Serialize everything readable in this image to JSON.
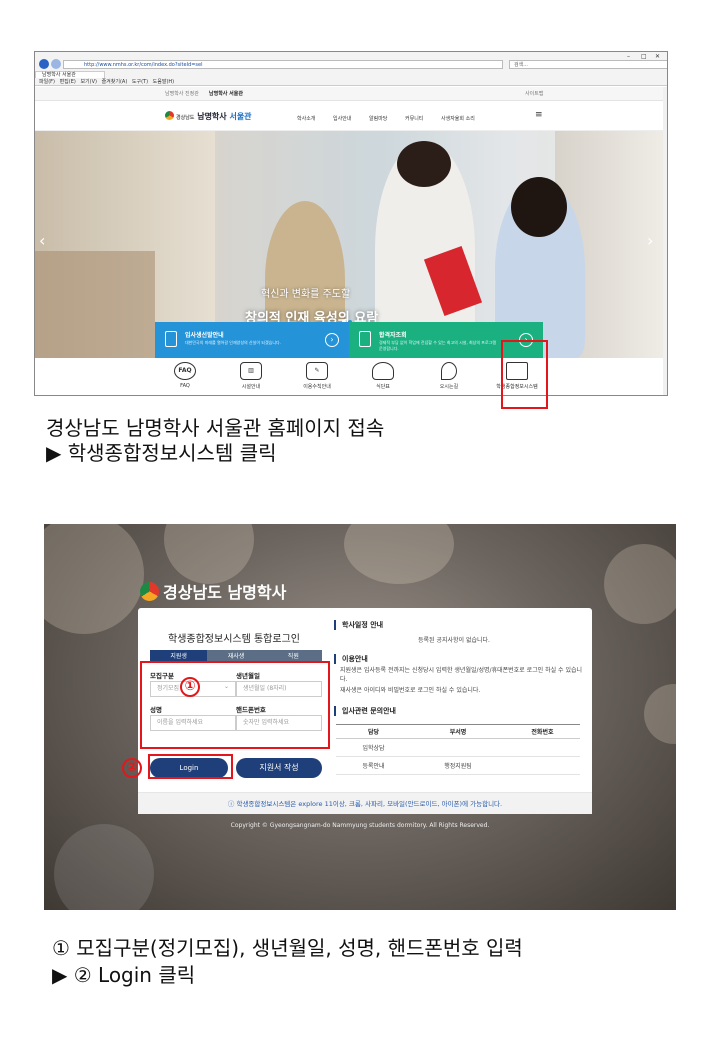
{
  "browser": {
    "url": "http://www.nmhs.or.kr/com/index.do?siteId=sel",
    "search_placeholder": "검색...",
    "tab_title": "남명학사 서울관",
    "menu_items": [
      "파일(F)",
      "편집(E)",
      "보기(V)",
      "즐겨찾기(A)",
      "도구(T)",
      "도움말(H)"
    ]
  },
  "site": {
    "top_links": [
      "남명학사 진정관",
      "남명학사 서울관"
    ],
    "top_right": "사이트맵",
    "logo_org": "경상남도",
    "logo_name": "남명학사",
    "logo_sub": "서울관",
    "gnb": [
      "학사소개",
      "입사안내",
      "알림마당",
      "커뮤니티",
      "사생자율회 소리"
    ],
    "hero_line1": "혁신과 변화를 주도할",
    "hero_line2": "창의적 인재 육성의 요람",
    "banners": [
      {
        "title": "입사생선발안내",
        "desc": "대한민국의 미래를 열어갈 인재양성의 산실이 되겠습니다."
      },
      {
        "title": "합격자조회",
        "desc": "경제적 부담 없이 학업에 전념할 수 있는 최고의 시설, 최상의 프로그램 운영합니다."
      }
    ],
    "quick_links": [
      "FAQ",
      "시설안내",
      "이용수칙안내",
      "식단표",
      "오시는길",
      "학생종합정보시스템"
    ]
  },
  "caption1": {
    "line1": "경상남도 남명학사 서울관 홈페이지 접속",
    "line2": "▶ 학생종합정보시스템 클릭"
  },
  "login": {
    "brand": "경상남도 남명학사",
    "title": "학생종합정보시스템 통합로그인",
    "tabs": [
      "지원생",
      "재사생",
      "직원"
    ],
    "fields": {
      "recruit_label": "모집구분",
      "recruit_value": "정기모집",
      "birth_label": "생년월일",
      "birth_placeholder": "생년월일 (8자리)",
      "name_label": "성명",
      "name_placeholder": "이름을 입력하세요",
      "phone_label": "핸드폰번호",
      "phone_placeholder": "숫자만 입력하세요"
    },
    "login_button": "Login",
    "apply_button": "지원서 작성",
    "schedule_heading": "학사일정 안내",
    "schedule_text": "등록된 공지사항이 없습니다.",
    "guide_heading": "이용안내",
    "guide_lines": [
      "지원생은 입사등록 전까지는 신청당시 입력한 생년월일/성명/휴대폰번호로 로그인 하실 수 있습니다.",
      "재사생은 아이디와 비밀번호로 로그인 하실 수 있습니다."
    ],
    "contact_heading": "입사관련 문의안내",
    "contact_table": {
      "headers": [
        "담당",
        "부서명",
        "전화번호"
      ],
      "rows": [
        [
          "입학상담",
          "",
          ""
        ],
        [
          "등록안내",
          "행정지원팀",
          ""
        ]
      ]
    },
    "footer_notice": "학생종합정보시스템은 explore 11이상, 크롬, 사파리, 모바일(안드로이드, 아이폰)에 가능합니다.",
    "copyright": "Copyright © Gyeongsangnam-do Nammyung students dormitory. All Rights Reserved.",
    "markers": [
      "①",
      "②"
    ]
  },
  "caption2": {
    "line1": "① 모집구분(정기모집), 생년월일, 성명, 핸드폰번호 입력",
    "line2": "▶ ② Login 클릭"
  },
  "colors": {
    "highlight": "#e3171b",
    "navy": "#1f3f7a",
    "banner_blue": "#2593d8",
    "banner_green": "#1bb07f"
  }
}
